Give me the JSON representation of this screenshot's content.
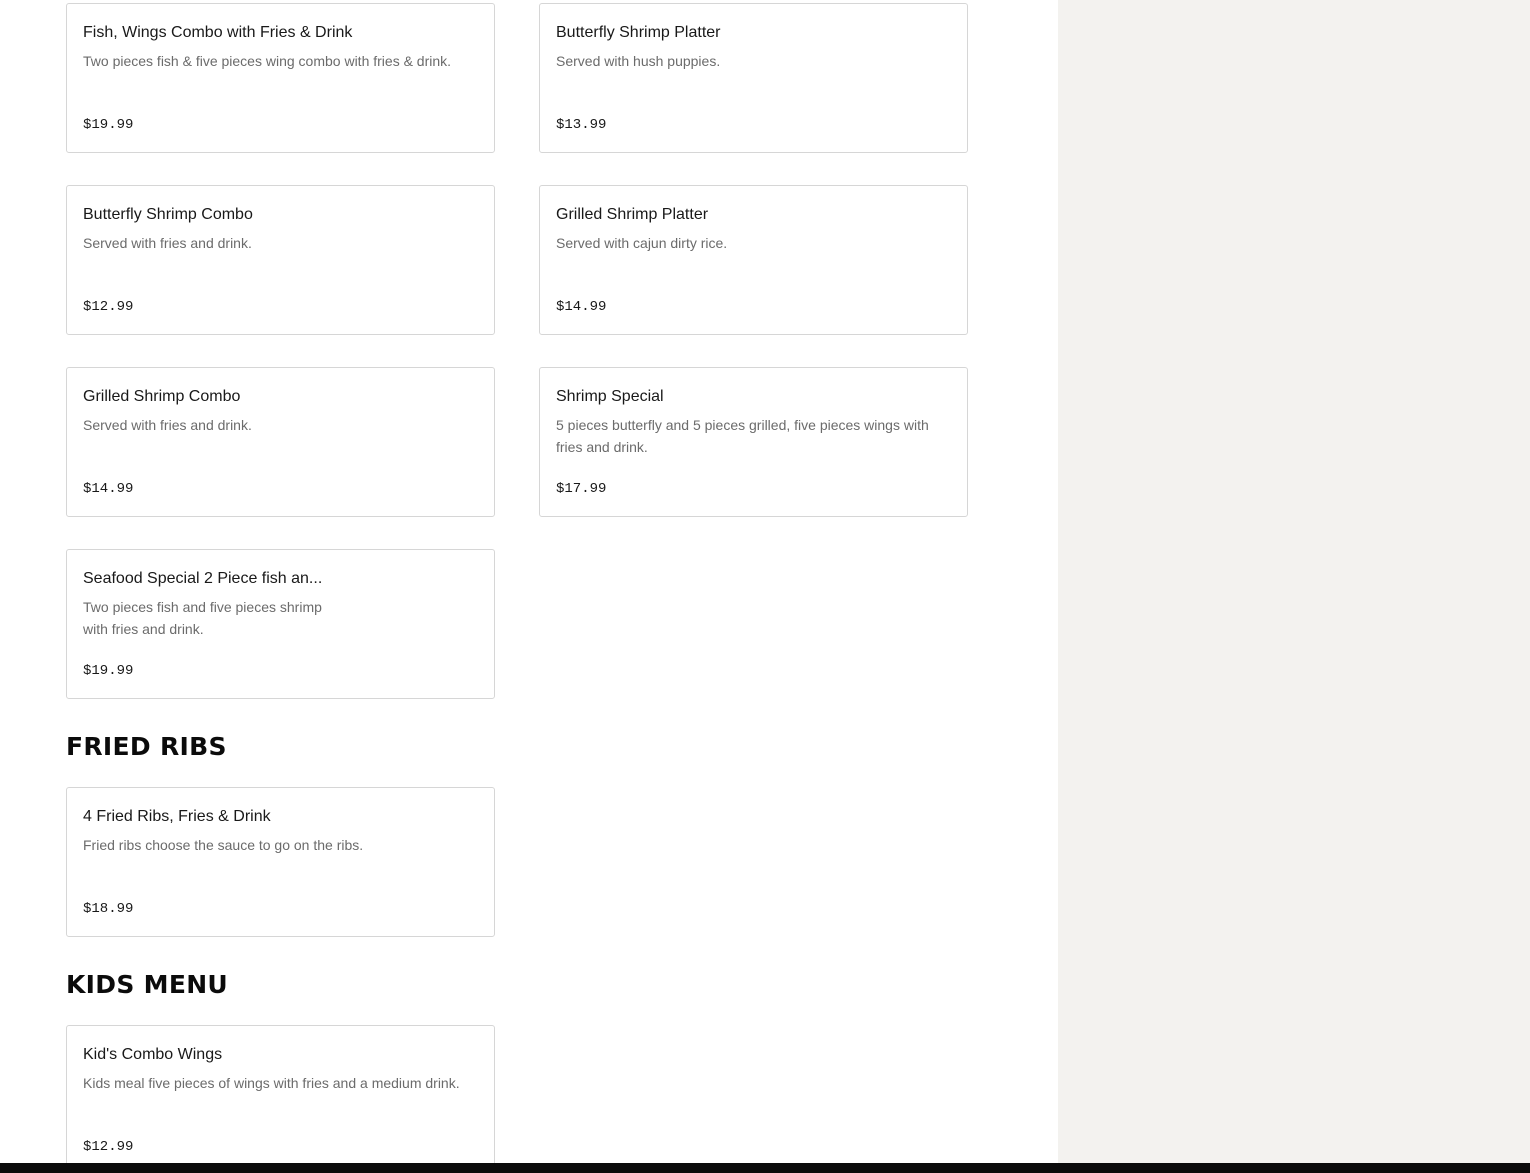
{
  "colors": {
    "page_background": "#ffffff",
    "side_panel_background": "#f3f2ef",
    "card_border": "#d6d6d6",
    "description_text": "#6b6b6b",
    "bottom_bar": "#0b0b0b"
  },
  "menu": {
    "seafood_items": [
      {
        "name": "Fish, Wings Combo with Fries & Drink",
        "description": "Two pieces fish & five pieces wing combo with fries & drink.",
        "price": "$19.99"
      },
      {
        "name": "Butterfly Shrimp Platter",
        "description": "Served with hush puppies.",
        "price": "$13.99"
      },
      {
        "name": "Butterfly Shrimp Combo",
        "description": "Served with fries and drink.",
        "price": "$12.99"
      },
      {
        "name": "Grilled Shrimp Platter",
        "description": "Served with cajun dirty rice.",
        "price": "$14.99"
      },
      {
        "name": "Grilled Shrimp Combo",
        "description": "Served with fries and drink.",
        "price": "$14.99"
      },
      {
        "name": "Shrimp Special",
        "description": "5 pieces butterfly and 5 pieces grilled, five pieces wings with fries and drink.",
        "price": "$17.99"
      },
      {
        "name": "Seafood Special 2 Piece fish an...",
        "description": "Two pieces fish and five pieces shrimp with fries and drink.",
        "price": "$19.99"
      }
    ],
    "fried_ribs": {
      "title": "FRIED RIBS",
      "items": [
        {
          "name": "4 Fried Ribs, Fries & Drink",
          "description": "Fried ribs choose the sauce to go on the ribs.",
          "price": "$18.99"
        }
      ]
    },
    "kids_menu": {
      "title": "KIDS MENU",
      "items": [
        {
          "name": "Kid's Combo Wings",
          "description": "Kids meal five pieces of wings with fries and a medium drink.",
          "price": "$12.99"
        }
      ]
    }
  }
}
